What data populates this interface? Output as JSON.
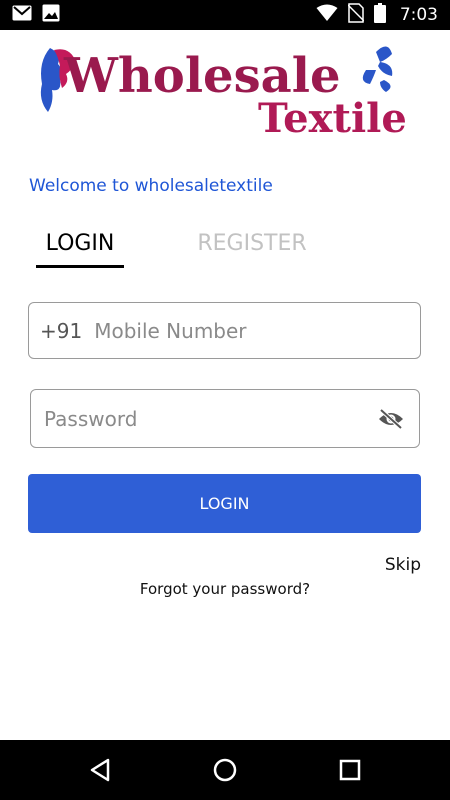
{
  "status_bar": {
    "time": "7:03",
    "left_icons": [
      "gmail-icon",
      "image-icon"
    ],
    "right_icons": [
      "wifi-icon",
      "no-sim-icon",
      "battery-icon"
    ]
  },
  "logo": {
    "line1": "Wholesale",
    "line2": "Textile"
  },
  "welcome_text": "Welcome to wholesaletextile",
  "tabs": {
    "login": "LOGIN",
    "register": "REGISTER",
    "active": "login"
  },
  "mobile_field": {
    "prefix": "+91",
    "placeholder": "Mobile Number",
    "value": ""
  },
  "password_field": {
    "placeholder": "Password",
    "value": "",
    "toggle_icon": "eye-off-icon"
  },
  "login_button_label": "LOGIN",
  "skip_label": "Skip",
  "forgot_label": "Forgot your password?",
  "nav_bar": {
    "icons": [
      "back-icon",
      "home-icon",
      "recents-icon"
    ]
  },
  "colors": {
    "accent": "#2f5fd6",
    "welcome": "#1f56d6",
    "logo_wholesale": "#9a1a4e",
    "logo_textile": "#b01a56",
    "logo_figure": "#2a56c8"
  }
}
